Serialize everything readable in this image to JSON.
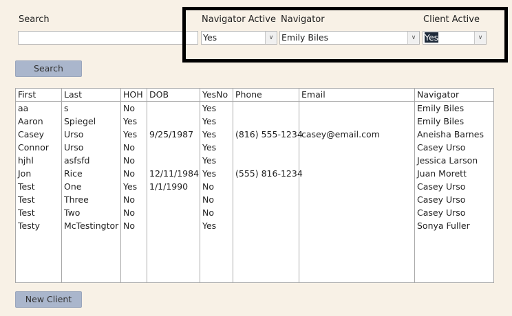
{
  "filters": {
    "search_label": "Search",
    "search_value": "",
    "navigator_active_label": "Navigator Active",
    "navigator_active_value": "Yes",
    "navigator_label": "Navigator",
    "navigator_value": "Emily Biles",
    "client_active_label": "Client Active",
    "client_active_value": "Yes"
  },
  "buttons": {
    "search": "Search",
    "new_client": "New Client"
  },
  "table": {
    "columns": [
      "First",
      "Last",
      "HOH",
      "DOB",
      "YesNo",
      "Phone",
      "Email",
      "Navigator"
    ],
    "rows": [
      [
        "aa",
        "s",
        "No",
        "",
        "Yes",
        "",
        "",
        "Emily Biles"
      ],
      [
        "Aaron",
        "Spiegel",
        "Yes",
        "",
        "Yes",
        "",
        "",
        "Emily Biles"
      ],
      [
        "Casey",
        "Urso",
        "Yes",
        "9/25/1987",
        "Yes",
        "(816) 555-1234",
        "casey@email.com",
        "Aneisha Barnes"
      ],
      [
        "Connor",
        "Urso",
        "No",
        "",
        "Yes",
        "",
        "",
        "Casey Urso"
      ],
      [
        "hjhl",
        "asfsfd",
        "No",
        "",
        "Yes",
        "",
        "",
        "Jessica Larson"
      ],
      [
        "Jon",
        "Rice",
        "No",
        "12/11/1984",
        "Yes",
        "(555) 816-1234",
        "",
        "Juan Morett"
      ],
      [
        "Test",
        "One",
        "Yes",
        "1/1/1990",
        "No",
        "",
        "",
        "Casey Urso"
      ],
      [
        "Test",
        "Three",
        "No",
        "",
        "No",
        "",
        "",
        "Casey Urso"
      ],
      [
        "Test",
        "Two",
        "No",
        "",
        "No",
        "",
        "",
        "Casey Urso"
      ],
      [
        "Testy",
        "McTestingtor",
        "No",
        "",
        "Yes",
        "",
        "",
        "Sonya Fuller"
      ]
    ]
  }
}
